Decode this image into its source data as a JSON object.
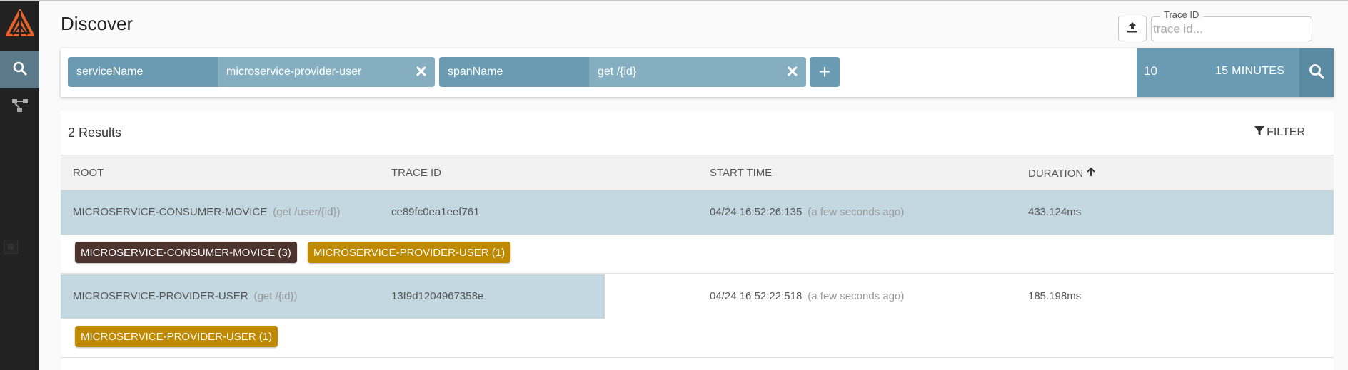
{
  "page": {
    "title": "Discover"
  },
  "trace_lookup": {
    "label": "Trace ID",
    "placeholder": "trace id..."
  },
  "search": {
    "criteria": [
      {
        "key": "serviceName",
        "value": "microservice-provider-user"
      },
      {
        "key": "spanName",
        "value": "get /{id}"
      }
    ],
    "limit": "10",
    "lookback": "15 MINUTES"
  },
  "results": {
    "count_label": "2 Results",
    "filter_label": "FILTER",
    "columns": [
      "ROOT",
      "TRACE ID",
      "START TIME",
      "DURATION"
    ],
    "sort_icon": "arrow-up-icon",
    "rows": [
      {
        "root": "MICROSERVICE-CONSUMER-MOVICE",
        "root_span": "(get /user/{id})",
        "trace_id": "ce89fc0ea1eef761",
        "start_time": "04/24 16:52:26:135",
        "start_relative": "(a few seconds ago)",
        "duration": "433.124ms",
        "duration_fraction": 1.0,
        "services": [
          {
            "label": "MICROSERVICE-CONSUMER-MOVICE (3)",
            "color": "#4e342e"
          },
          {
            "label": "MICROSERVICE-PROVIDER-USER (1)",
            "color": "#bf8a00"
          }
        ]
      },
      {
        "root": "MICROSERVICE-PROVIDER-USER",
        "root_span": "(get /{id})",
        "trace_id": "13f9d1204967358e",
        "start_time": "04/24 16:52:22:518",
        "start_relative": "(a few seconds ago)",
        "duration": "185.198ms",
        "duration_fraction": 0.4276,
        "services": [
          {
            "label": "MICROSERVICE-PROVIDER-USER (1)",
            "color": "#bf8a00"
          }
        ]
      }
    ]
  },
  "colors": {
    "sidebar": "#222222",
    "accent": "#6a9bb2",
    "duration_bar": "#c4d8e1",
    "logo": "#e8632b"
  }
}
